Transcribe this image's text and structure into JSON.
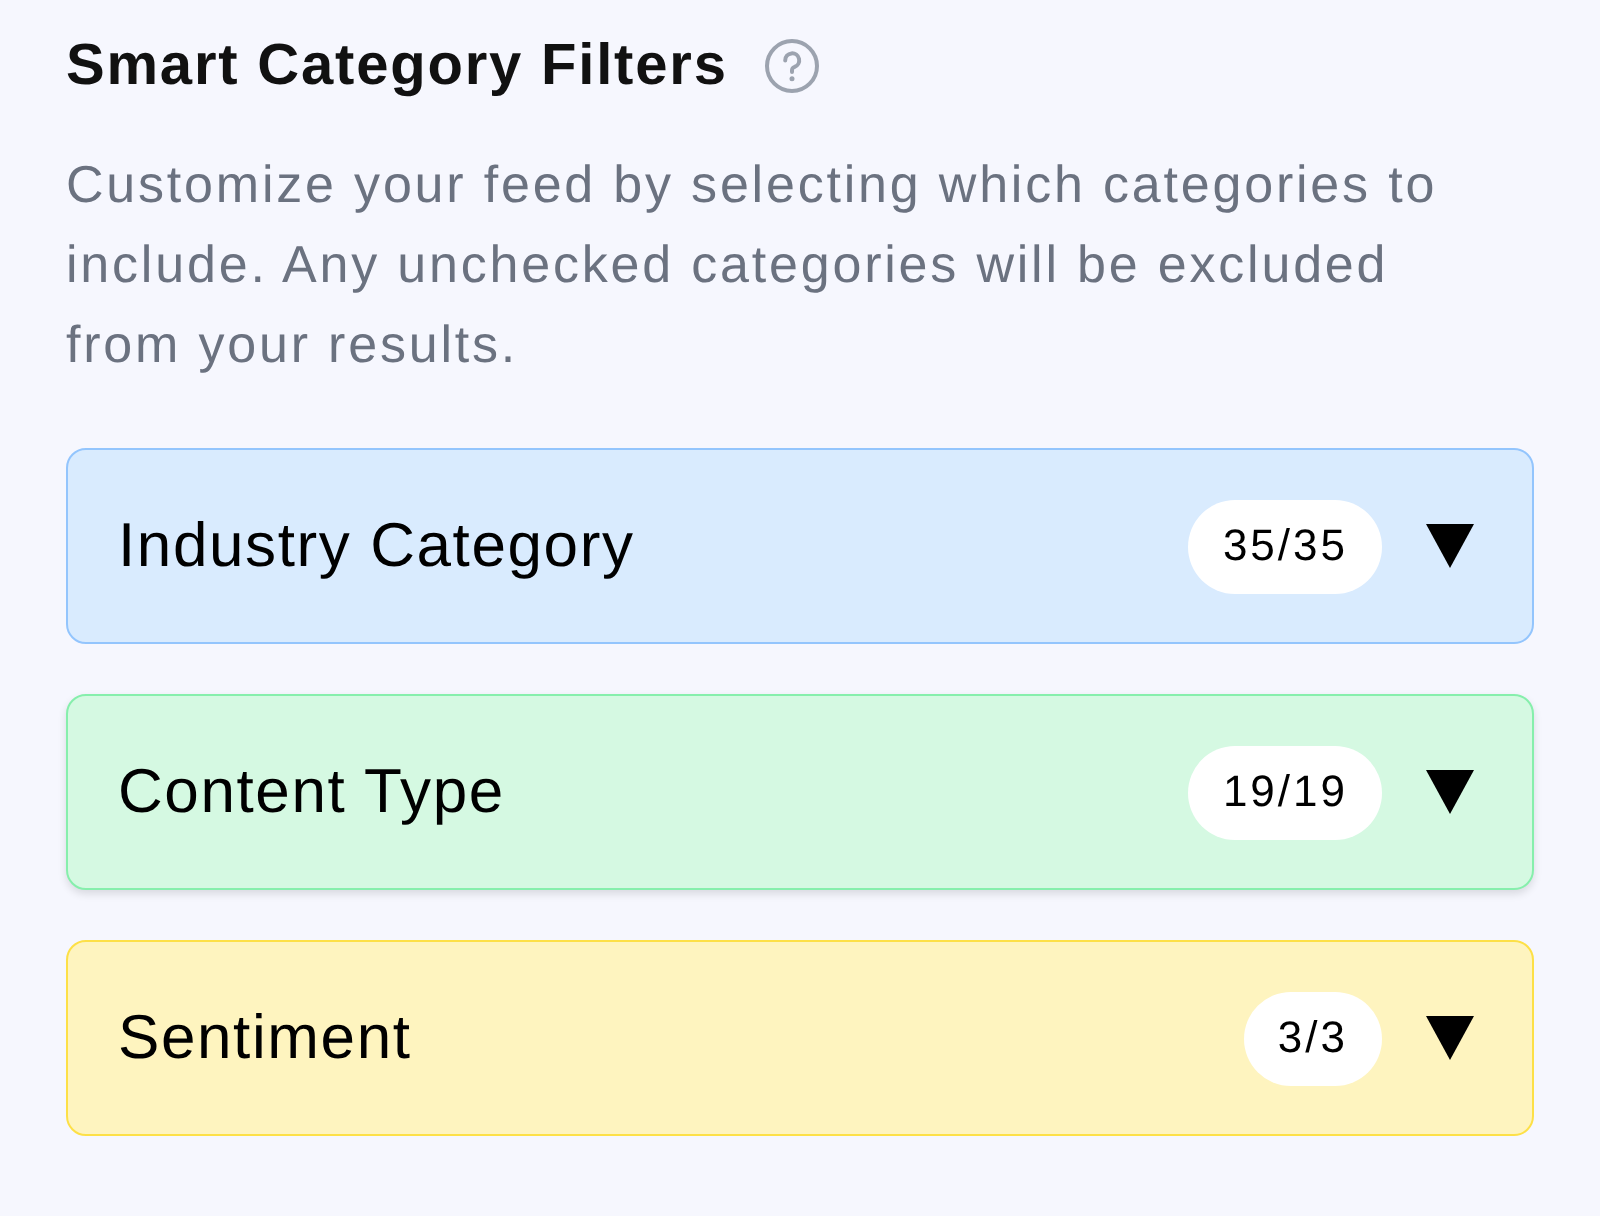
{
  "header": {
    "title": "Smart Category Filters",
    "description": "Customize your feed by selecting which categories to include. Any unchecked categories will be excluded from your results."
  },
  "sections": [
    {
      "label": "Industry Category",
      "count": "35/35",
      "color": "#93c5fd",
      "expanded": false,
      "hovered": false
    },
    {
      "label": "Content Type",
      "count": "19/19",
      "color": "#86efac",
      "expanded": false,
      "hovered": true
    },
    {
      "label": "Sentiment",
      "count": "3/3",
      "color": "#fde047",
      "expanded": false,
      "hovered": false
    }
  ]
}
